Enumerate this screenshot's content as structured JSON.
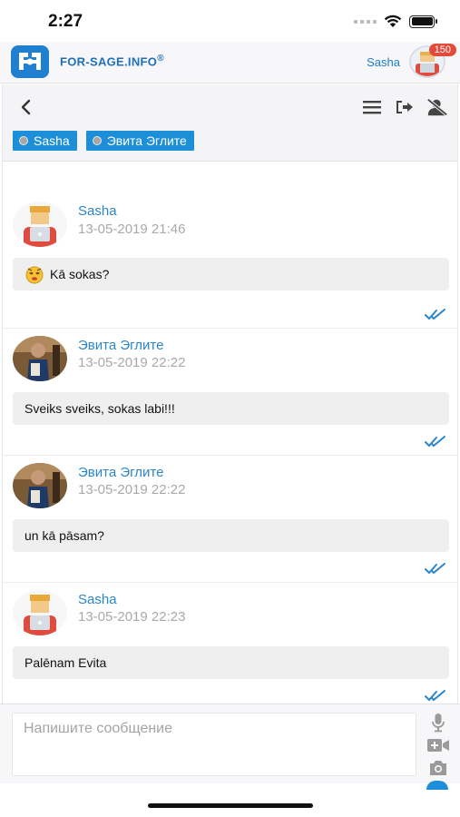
{
  "status": {
    "time": "2:27"
  },
  "header": {
    "brand": "FOR-SAGE.INFO",
    "brand_mark": "®",
    "user": "Sasha",
    "badge": "150"
  },
  "participants": [
    {
      "name": "Sasha"
    },
    {
      "name": "Эвита Эглите"
    }
  ],
  "messages": [
    {
      "author": "Sasha",
      "time": "13-05-2019 21:46",
      "text": "Kā sokas?",
      "has_emoji": true,
      "avatar": "sasha"
    },
    {
      "author": "Эвита Эглите",
      "time": "13-05-2019 22:22",
      "text": "Sveiks sveiks, sokas labi!!!",
      "has_emoji": false,
      "avatar": "evita"
    },
    {
      "author": "Эвита Эглите",
      "time": "13-05-2019 22:22",
      "text": "un kā pāsam?",
      "has_emoji": false,
      "avatar": "evita"
    },
    {
      "author": "Sasha",
      "time": "13-05-2019 22:23",
      "text": "Palēnam Evita",
      "has_emoji": false,
      "avatar": "sasha"
    }
  ],
  "composer": {
    "placeholder": "Напишите сообщение",
    "value": ""
  },
  "colors": {
    "accent": "#1d8fd8",
    "name": "#2a86cc",
    "badge": "#e34a3c",
    "read": "#2a86cc"
  }
}
